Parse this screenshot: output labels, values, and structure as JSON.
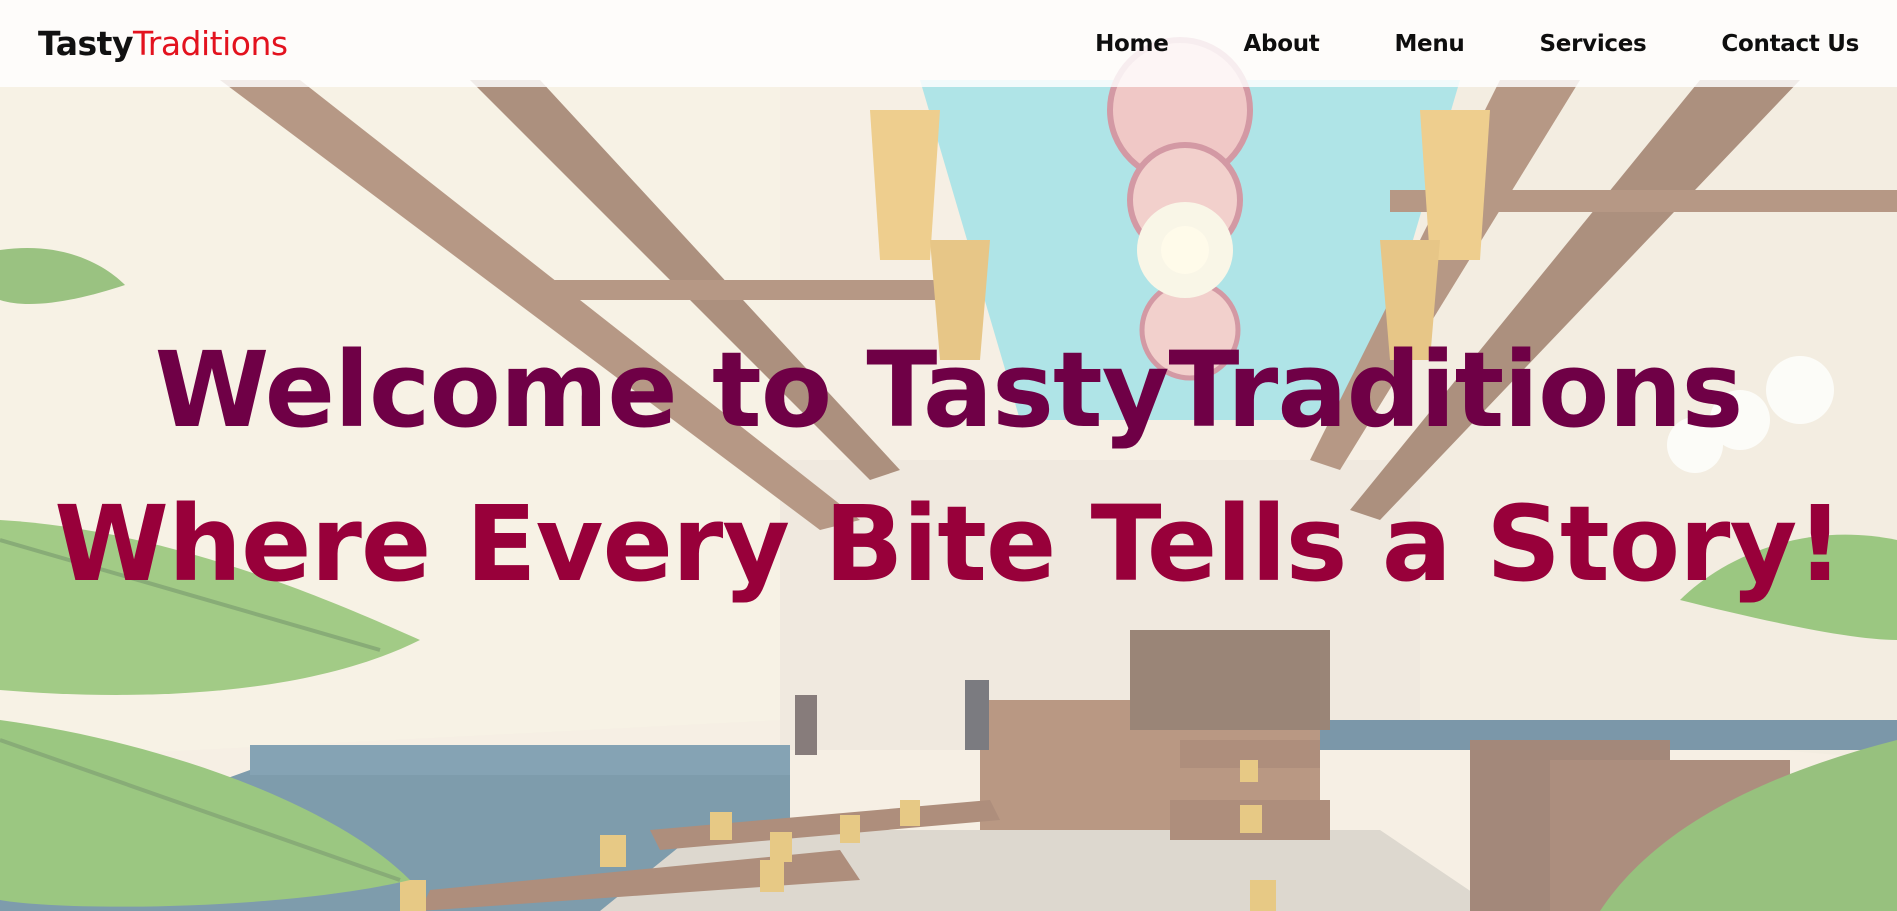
{
  "brand": {
    "part1": "Tasty",
    "part2": "Traditions",
    "color1": "#111111",
    "color2": "#e3121e"
  },
  "nav": {
    "items": [
      {
        "label": "Home"
      },
      {
        "label": "About"
      },
      {
        "label": "Menu"
      },
      {
        "label": "Services"
      },
      {
        "label": "Contact Us"
      }
    ]
  },
  "hero": {
    "title": "Welcome to TastyTraditions",
    "subtitle": "Where Every Bite Tells a Story!",
    "title_color": "#6f0046",
    "subtitle_color": "#98003a",
    "background_image": "restaurant interior with decorated ceiling, lamps, wooden tables and banana leaves"
  }
}
